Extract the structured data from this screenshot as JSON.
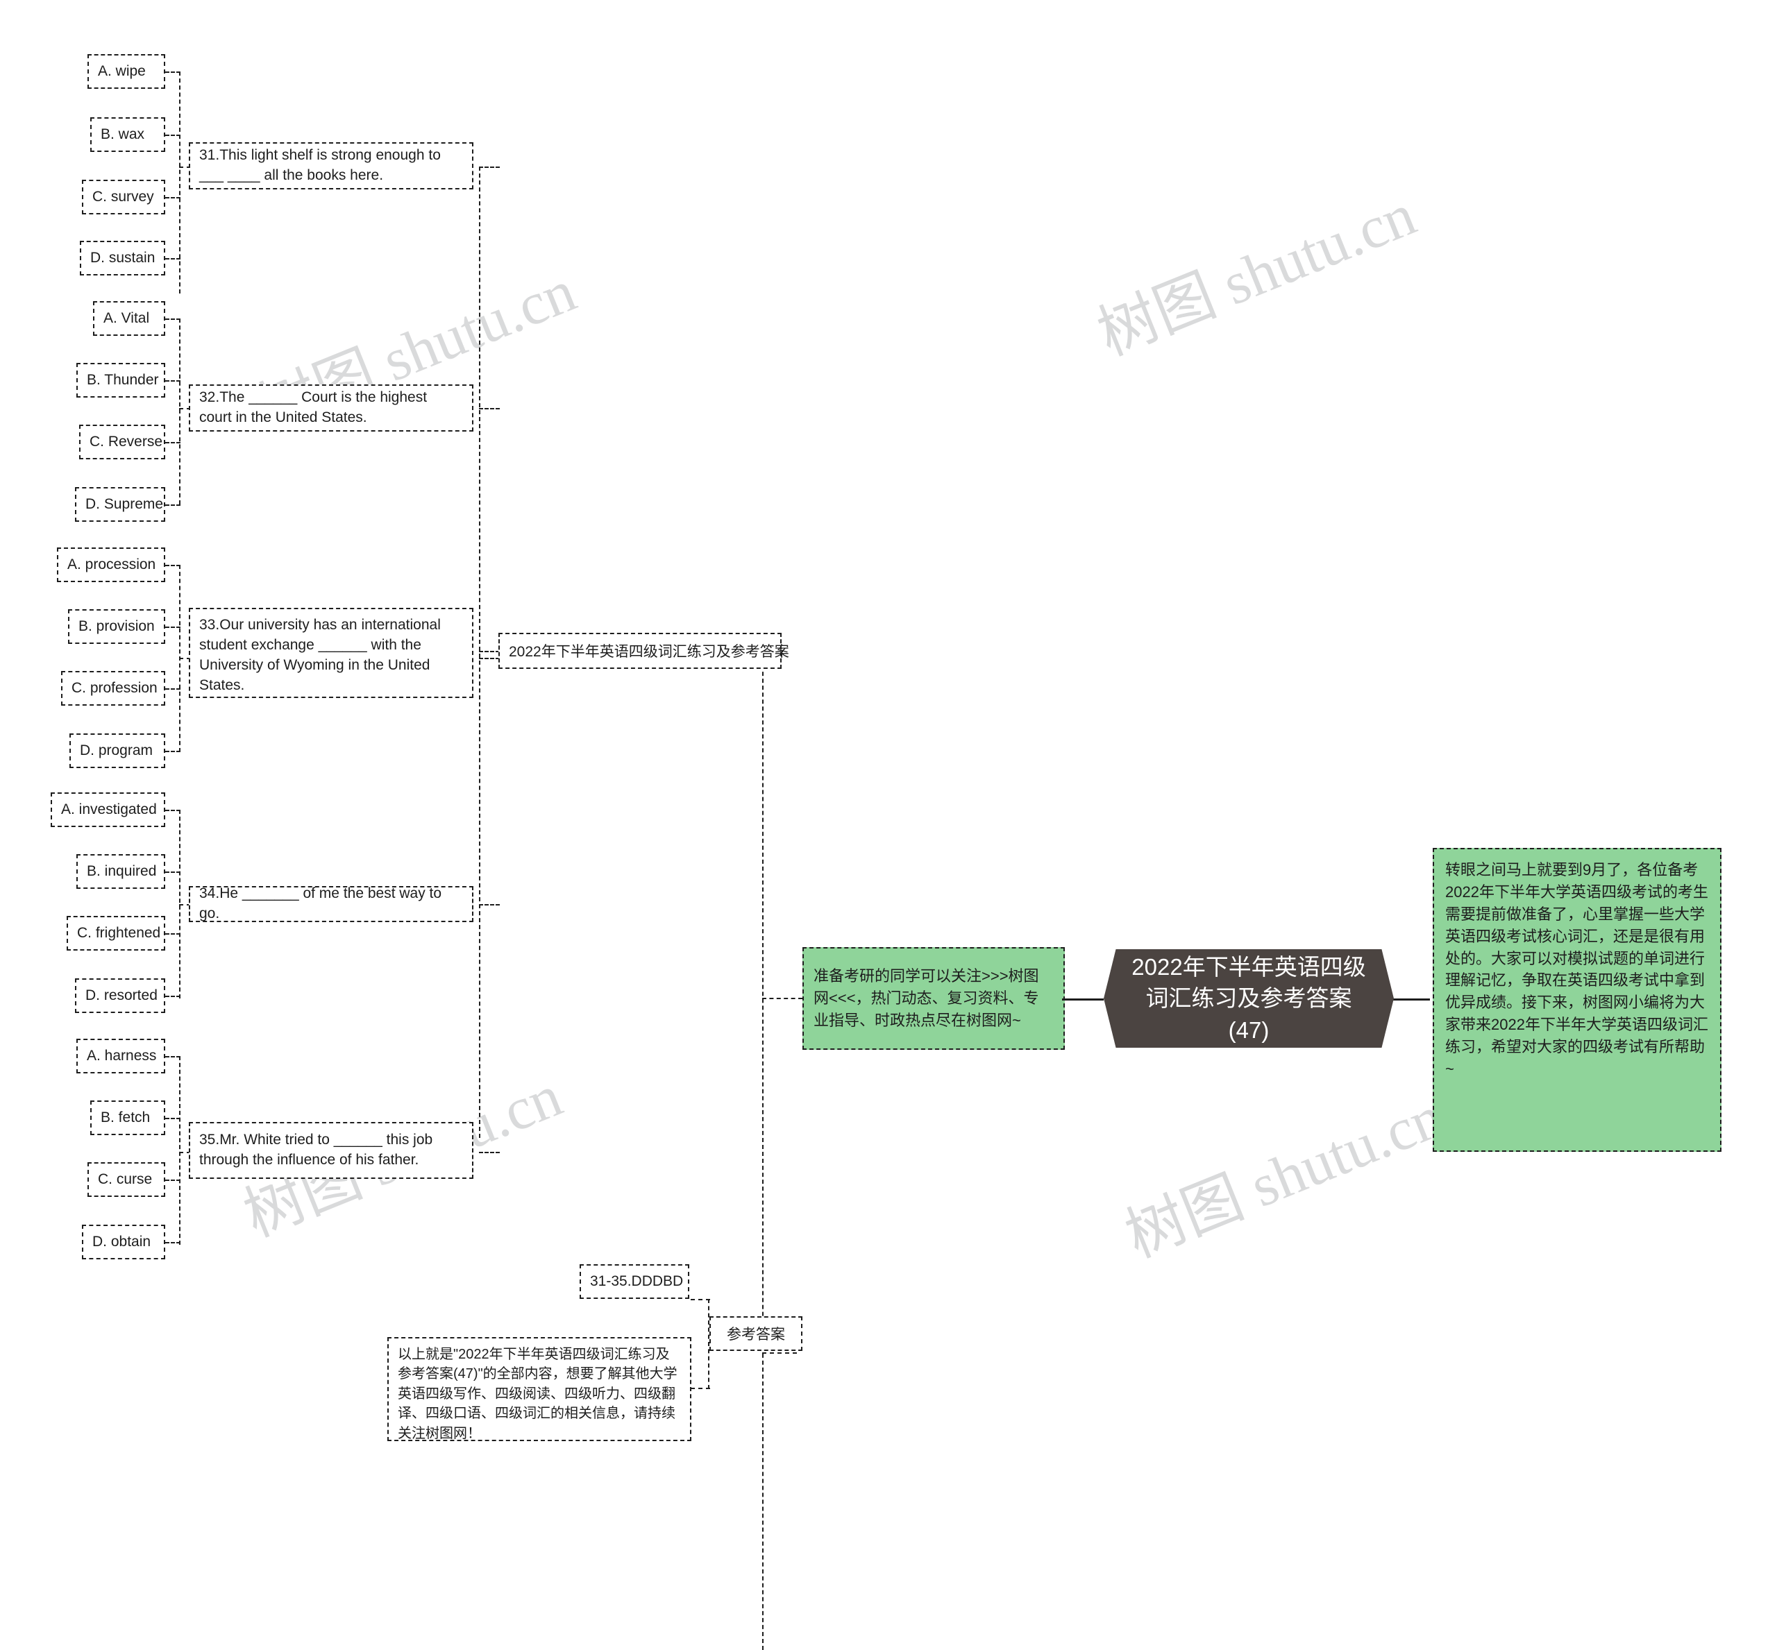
{
  "root": {
    "title": "2022年下半年英语四级词汇练习及参考答案(47)"
  },
  "watermark": {
    "text": "树图 shutu.cn"
  },
  "left_branch": {
    "label": "2022年下半年英语四级词汇练习及参考答案",
    "questions": [
      {
        "text": "31.This light shelf is strong enough to ___ ____ all the books here.",
        "options": [
          "A. wipe",
          "B. wax",
          "C. survey",
          "D. sustain"
        ]
      },
      {
        "text": "32.The ______ Court is the highest court in the United States.",
        "options": [
          "A. Vital",
          "B. Thunder",
          "C. Reverse",
          "D. Supreme"
        ]
      },
      {
        "text": "33.Our university has an international student exchange ______ with the University of Wyoming in the United States.",
        "options": [
          "A. procession",
          "B. provision",
          "C. profession",
          "D. program"
        ]
      },
      {
        "text": "34.He _______ of me the best way to go.",
        "options": [
          "A. investigated",
          "B. inquired",
          "C. frightened",
          "D. resorted"
        ]
      },
      {
        "text": "35.Mr. White tried to ______ this job through the influence of his father.",
        "options": [
          "A. harness",
          "B. fetch",
          "C. curse",
          "D. obtain"
        ]
      }
    ]
  },
  "answers_branch": {
    "label": "参考答案",
    "answer_key": "31-35.DDDBD",
    "closing": "以上就是\"2022年下半年英语四级词汇练习及参考答案(47)\"的全部内容，想要了解其他大学英语四级写作、四级阅读、四级听力、四级翻译、四级口语、四级词汇的相关信息，请持续关注树图网！"
  },
  "note_left": {
    "text": "准备考研的同学可以关注>>>树图网<<<，热门动态、复习资料、专业指导、时政热点尽在树图网~"
  },
  "note_right": {
    "text": "转眼之间马上就要到9月了，各位备考2022年下半年大学英语四级考试的考生需要提前做准备了，心里掌握一些大学英语四级考试核心词汇，还是是很有用处的。大家可以对模拟试题的单词进行理解记忆，争取在英语四级考试中拿到优异成绩。接下来，树图网小编将为大家带来2022年下半年大学英语四级词汇练习，希望对大家的四级考试有所帮助~"
  },
  "colors": {
    "root_fill": "#4b4441",
    "note_fill": "#8fd49a",
    "stroke": "#1d1d1d",
    "watermark": "#d9dadb"
  }
}
